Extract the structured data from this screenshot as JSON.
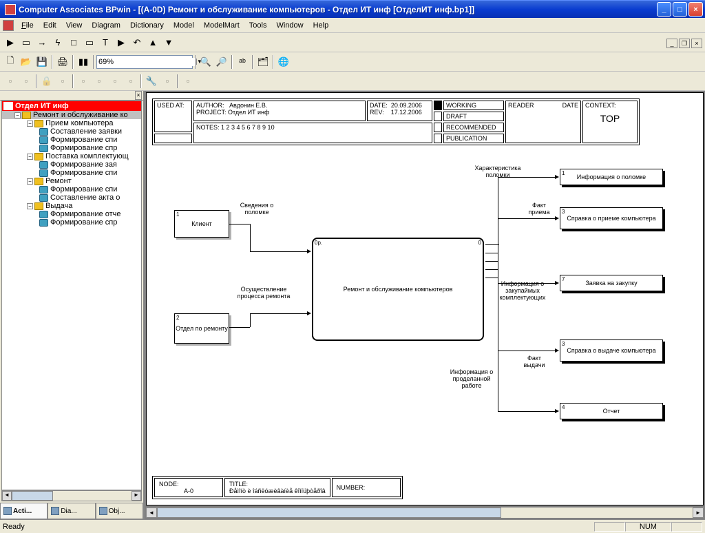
{
  "titlebar": {
    "text": "Computer Associates BPwin - [(A-0D) Ремонт и обслуживание компьютеров - Отдел ИТ инф  [ОтделИТ инф.bp1]]"
  },
  "menu": {
    "file": "File",
    "edit": "Edit",
    "view": "View",
    "diagram": "Diagram",
    "dictionary": "Dictionary",
    "model": "Model",
    "modelmart": "ModelMart",
    "tools": "Tools",
    "window": "Window",
    "help": "Help"
  },
  "zoom": "69%",
  "tree": {
    "root": "Отдел ИТ инф",
    "n0": "Ремонт и обслуживание ко",
    "n1": "Прием компьютера",
    "n1a": "Составление заявки",
    "n1b": "Формирование спи",
    "n1c": "Формирование спр",
    "n2": "Поставка комплектующ",
    "n2a": "Формирование зая",
    "n2b": "Формирование спи",
    "n3": "Ремонт",
    "n3a": "Формирование спи",
    "n3b": "Составление акта о",
    "n4": "Выдача",
    "n4a": "Формирование отче",
    "n4b": "Формирование спр"
  },
  "tabs": {
    "t1": "Acti...",
    "t2": "Dia...",
    "t3": "Obj..."
  },
  "header": {
    "used_at_label": "USED AT:",
    "author_label": "AUTHOR:",
    "author": "Авдонин Е.В.",
    "project_label": "PROJECT:",
    "project": "Отдел ИТ инф",
    "date_label": "DATE:",
    "date": "20.09.2006",
    "rev_label": "REV:",
    "rev": "17.12.2006",
    "notes": "NOTES:  1  2  3  4  5  6  7  8  9  10",
    "working": "WORKING",
    "draft": "DRAFT",
    "rec": "RECOMMENDED",
    "pub": "PUBLICATION",
    "reader": "READER",
    "rdate": "DATE",
    "context": "CONTEXT:",
    "top": "TOP"
  },
  "diagram": {
    "client": "Клиент",
    "client_n": "1",
    "dept": "Отдел по ремонту",
    "dept_n": "2",
    "main": "Ремонт и обслуживание компьютеров",
    "main_n": "0р.",
    "main_r": "0",
    "in1": "Сведения о поломке",
    "in2": "Осуществление процесса ремонта",
    "out1": "Информация о поломке",
    "out1_n": "1",
    "out2": "Справка о приеме компьютера",
    "out2_n": "3",
    "out3": "Заявка на закупку",
    "out3_n": "7",
    "out4": "Справка о выдаче компьютера",
    "out4_n": "3",
    "out5": "Отчет",
    "out5_n": "4",
    "lbl1": "Характеристика поломки",
    "lbl2": "Факт приема",
    "lbl3": "Информация о закупаймых комплектующих",
    "lbl4": "Факт выдачи",
    "lbl5": "Информация о проделанной работе"
  },
  "footer": {
    "node_label": "NODE:",
    "node": "A-0",
    "title_label": "TITLE:",
    "title": "Ðåìîíò è îáñëóæèâàíèå êîìïüþòåðîâ",
    "number_label": "NUMBER:"
  },
  "status": {
    "ready": "Ready",
    "num": "NUM"
  }
}
